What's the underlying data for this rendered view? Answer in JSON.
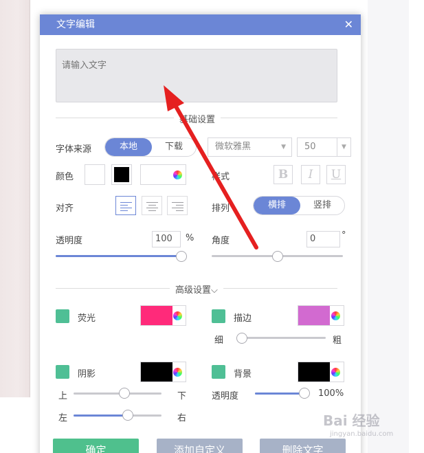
{
  "dialog": {
    "title": "文字编辑",
    "close_glyph": "✕"
  },
  "text_input": {
    "placeholder": "请输入文字",
    "value": ""
  },
  "basic": {
    "section_title": "基础设置",
    "font_source_label": "字体来源",
    "font_source_options": [
      "本地",
      "下载"
    ],
    "font_source_selected": "本地",
    "font_family": "微软雅黑",
    "font_size": "50",
    "color_label": "颜色",
    "style_label": "样式",
    "style_buttons": [
      "B",
      "I",
      "U"
    ],
    "align_label": "对齐",
    "arrange_label": "排列",
    "arrange_options": [
      "横排",
      "竖排"
    ],
    "arrange_selected": "横排",
    "opacity_label": "透明度",
    "opacity_value": "100",
    "opacity_unit": "%",
    "opacity_level": 1.0,
    "angle_label": "角度",
    "angle_value": "0",
    "angle_unit": "°",
    "angle_level": 0.5
  },
  "advanced": {
    "section_title": "高级设置",
    "section_chevron": "⌵",
    "glow_label": "荧光",
    "glow_color": "#ff2a7a",
    "stroke_label": "描边",
    "stroke_color": "#d26ad0",
    "stroke_thin": "细",
    "stroke_thick": "粗",
    "stroke_level": 0.05,
    "shadow_label": "阴影",
    "shadow_color": "#000000",
    "shadow_up": "上",
    "shadow_down": "下",
    "shadow_left": "左",
    "shadow_right": "右",
    "shadow_vertical_level": 0.58,
    "shadow_horizontal_level": 0.62,
    "background_label": "背景",
    "background_color": "#000000",
    "bg_opacity_label": "透明度",
    "bg_opacity_value": "100%",
    "bg_opacity_level": 1.0
  },
  "buttons": {
    "confirm": "确定",
    "add_custom": "添加自定义",
    "delete_text": "删除文字"
  },
  "colors": {
    "accent": "#6b86d6",
    "check": "#4fbf95",
    "confirm_bg": "#4fc08d",
    "secondary_bg": "#a7b2c7",
    "annotation_arrow": "#e52020"
  },
  "watermark": {
    "logo": "Bai 经验",
    "url": "jingyan.baidu.com"
  }
}
